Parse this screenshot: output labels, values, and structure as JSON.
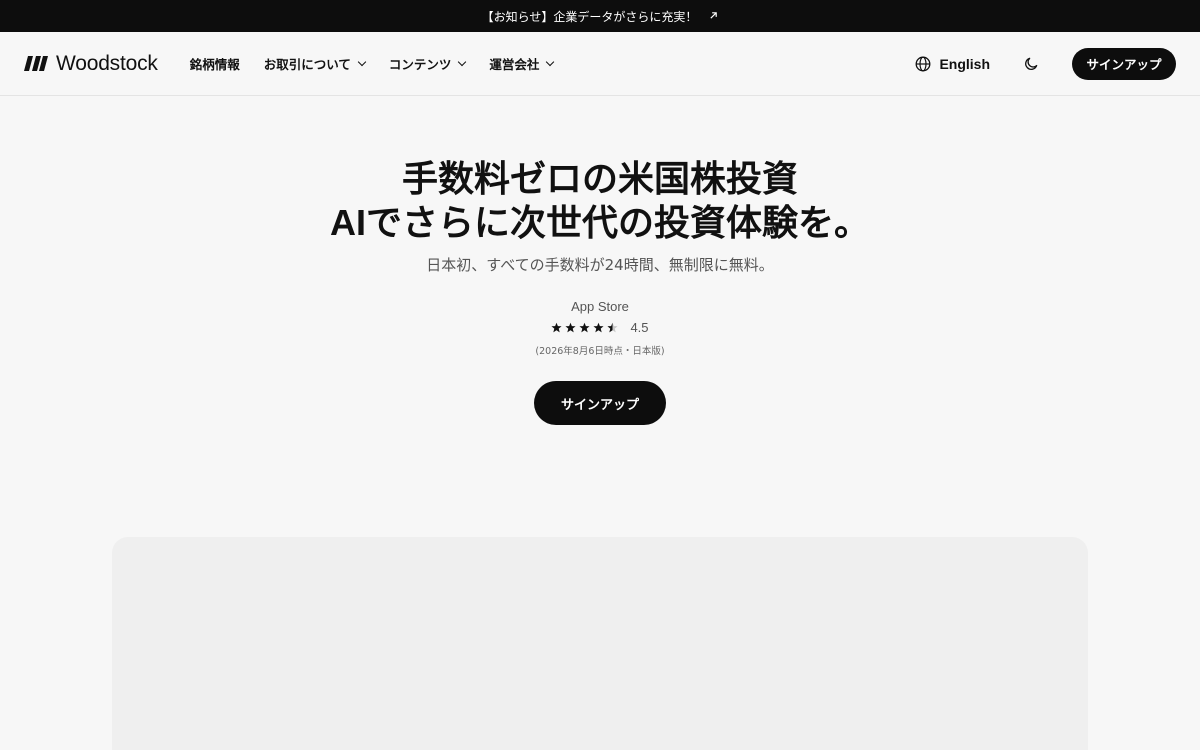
{
  "announcement": {
    "text": "【お知らせ】企業データがさらに充実！",
    "icon": "external-arrow-icon"
  },
  "nav": {
    "brand": "Woodstock",
    "links": [
      {
        "label": "銘柄情報",
        "dropdown": false
      },
      {
        "label": "お取引について",
        "dropdown": true
      },
      {
        "label": "コンテンツ",
        "dropdown": true
      },
      {
        "label": "運営会社",
        "dropdown": true
      }
    ],
    "language": "English",
    "signup": "サインアップ"
  },
  "hero": {
    "title_line1": "手数料ゼロの米国株投資",
    "title_line2_ai": "AI",
    "title_line2_rest": "でさらに次世代の投資体験を。",
    "subtitle": "日本初、すべての手数料が24時間、無制限に無料。",
    "store": "App Store",
    "rating": "4.5",
    "rating_stars": 4.5,
    "rating_note": "(2026年8月6日時点・日本版)",
    "signup": "サインアップ"
  },
  "colors": {
    "background": "#f7f7f7",
    "dark": "#0d0d0d",
    "panel": "#efefef"
  }
}
